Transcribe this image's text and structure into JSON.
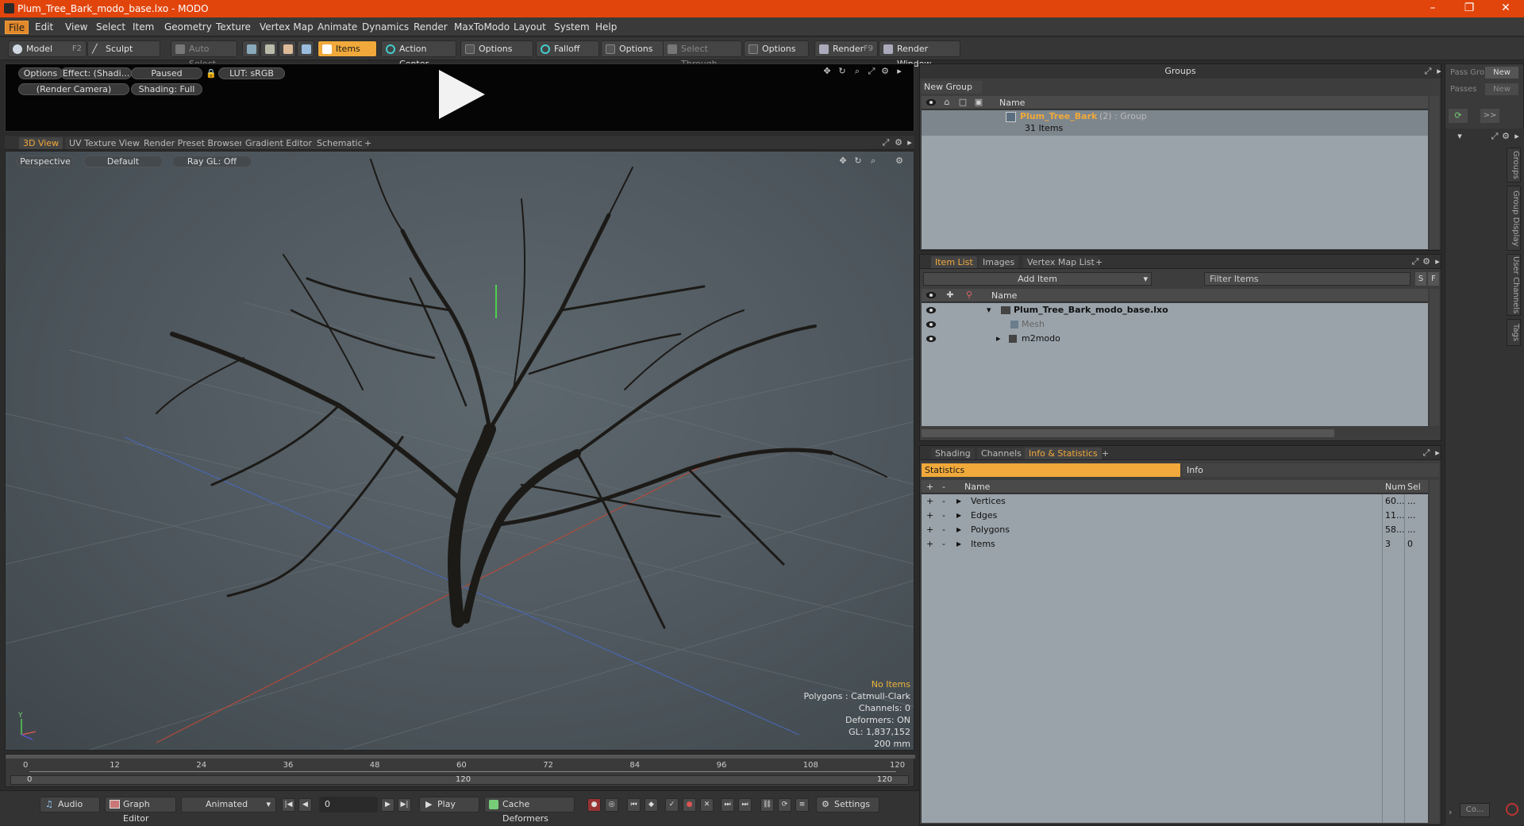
{
  "window": {
    "title": "Plum_Tree_Bark_modo_base.lxo - MODO",
    "controls": [
      "–",
      "❐",
      "✕"
    ]
  },
  "menu": [
    "File",
    "Edit",
    "View",
    "Select",
    "Item",
    "Geometry",
    "Texture",
    "Vertex Map",
    "Animate",
    "Dynamics",
    "Render",
    "MaxToModo",
    "Layout",
    "System",
    "Help"
  ],
  "toolbar": {
    "model": "Model",
    "model_key": "F2",
    "sculpt": "Sculpt",
    "auto_select": "Auto Select",
    "items": "Items",
    "action_center": "Action Center",
    "options1": "Options",
    "falloff": "Falloff",
    "options2": "Options",
    "select_through": "Select Through",
    "options3": "Options",
    "render": "Render",
    "render_key": "F9",
    "render_window": "Render Window"
  },
  "preview": {
    "options": "Options",
    "effect": "Effect: (Shadi...",
    "paused": "Paused",
    "lut": "LUT: sRGB",
    "camera": "(Render Camera)",
    "shading": "Shading: Full"
  },
  "view_tabs": [
    "3D View",
    "UV Texture View",
    "Render Preset Browser",
    "Gradient Editor",
    "Schematic",
    "+"
  ],
  "viewport": {
    "perspective": "Perspective",
    "default": "Default",
    "raygl": "Ray GL: Off",
    "info": {
      "no_items": "No Items",
      "polygons": "Polygons : Catmull-Clark",
      "channels": "Channels: 0",
      "deformers": "Deformers: ON",
      "gl": "GL: 1,837,152",
      "scale": "200 mm"
    },
    "axis_y": "Y"
  },
  "timeline": {
    "ticks": [
      "0",
      "12",
      "24",
      "36",
      "48",
      "60",
      "72",
      "84",
      "96",
      "108",
      "120"
    ],
    "range_start": "0",
    "range_mid": "120",
    "range_end": "120"
  },
  "bottom": {
    "audio": "Audio",
    "graph_editor": "Graph Editor",
    "animated": "Animated",
    "frame": "0",
    "play": "Play",
    "cache_deformers": "Cache Deformers",
    "settings": "Settings"
  },
  "groups": {
    "title": "Groups",
    "new_group": "New Group",
    "col_name": "Name",
    "item_name": "Plum_Tree_Bark",
    "item_suffix": "(2) : Group",
    "item_count": "31 Items"
  },
  "passes": {
    "pass_label": "Pass Gro",
    "new1": "New",
    "passes_label": "Passes",
    "new2": "New",
    "arrow": ">>"
  },
  "side_tabs": [
    "Groups",
    "Group Display",
    "User Channels",
    "Tags"
  ],
  "item_tabs": [
    "Item List",
    "Images",
    "Vertex Map List",
    "+"
  ],
  "item_list": {
    "add_item": "Add Item",
    "filter": "Filter Items",
    "s": "S",
    "f": "F",
    "col_name": "Name",
    "rows": [
      {
        "name": "Plum_Tree_Bark_modo_base.lxo"
      },
      {
        "name": "Mesh"
      },
      {
        "name": "m2modo"
      }
    ]
  },
  "info_tabs": [
    "Shading",
    "Channels",
    "Info & Statistics",
    "+"
  ],
  "stats": {
    "statistics": "Statistics",
    "info": "Info",
    "col_name": "Name",
    "col_num": "Num",
    "col_sel": "Sel",
    "rows": [
      {
        "name": "Vertices",
        "num": "60...",
        "sel": "..."
      },
      {
        "name": "Edges",
        "num": "11...",
        "sel": "..."
      },
      {
        "name": "Polygons",
        "num": "58...",
        "sel": "..."
      },
      {
        "name": "Items",
        "num": "3",
        "sel": "0"
      }
    ]
  },
  "bottom_right": {
    "co": "Co..."
  },
  "colors": {
    "title_bar": "#e2450c",
    "accent": "#f0a93a",
    "viewport_bg": "#4f5a60"
  }
}
